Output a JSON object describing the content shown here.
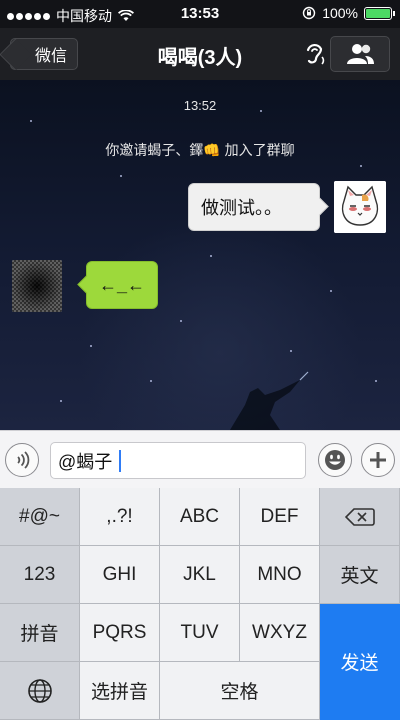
{
  "status_bar": {
    "carrier": "中国移动",
    "time": "13:53",
    "battery_percent": "100%",
    "battery_level": 1.0
  },
  "nav": {
    "back_label": "微信",
    "title": "喝喝(3人)",
    "icons": {
      "voice_mode": "ear-icon",
      "members": "group-members-icon"
    }
  },
  "chat": {
    "timestamp": "13:52",
    "system_message": "你邀请蝎子、鐸👊 加入了群聊",
    "messages": [
      {
        "side": "right",
        "text": "做测试。。",
        "avatar": "cat-avatar"
      },
      {
        "side": "left",
        "text": "←_←",
        "avatar": "noise-avatar"
      }
    ]
  },
  "input": {
    "value": "@蝎子",
    "icons": {
      "voice": "voice-wave-icon",
      "emoji": "smiley-icon",
      "plus": "plus-icon"
    }
  },
  "keyboard": {
    "colors": {
      "send": "#1e7cf2"
    },
    "keys": {
      "symbols": "#@~",
      "punct": ",.?!",
      "abc": "ABC",
      "def": "DEF",
      "backspace_icon": "backspace-icon",
      "num": "123",
      "ghi": "GHI",
      "jkl": "JKL",
      "mno": "MNO",
      "english": "英文",
      "pinyin": "拼音",
      "pqrs": "PQRS",
      "tuv": "TUV",
      "wxyz": "WXYZ",
      "send": "发送",
      "globe_icon": "globe-icon",
      "select_pinyin": "选拼音",
      "space": "空格"
    }
  }
}
